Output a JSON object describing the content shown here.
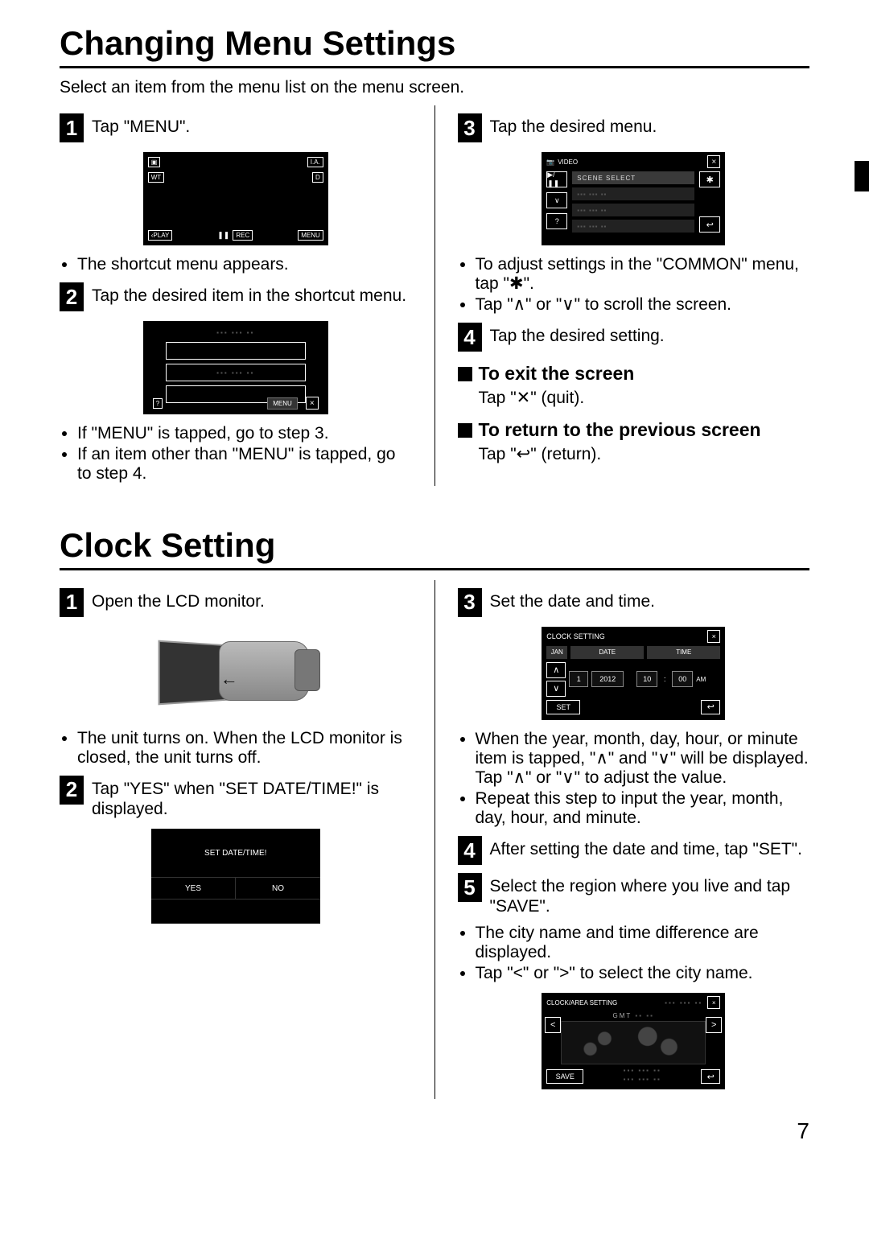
{
  "section1": {
    "title": "Changing Menu Settings",
    "intro": "Select an item from the menu list on the menu screen.",
    "left": {
      "step1": {
        "text": "Tap \"MENU\".",
        "lcd": {
          "wt": "WT",
          "ia": "I.A.",
          "d": "D",
          "play": "PLAY",
          "play_prefix": "‹",
          "rec": "REC",
          "rec_prefix": "❚❚",
          "menu": "MENU",
          "img_icon": "▣"
        },
        "bullets": [
          "The shortcut menu appears."
        ]
      },
      "step2": {
        "text": "Tap the desired item in the shortcut menu.",
        "lcd": {
          "menu": "MENU",
          "close": "×",
          "help": "?"
        },
        "bullets": [
          "If \"MENU\" is tapped, go to step 3.",
          "If an item other than \"MENU\" is tapped, go to step 4."
        ]
      }
    },
    "right": {
      "step3": {
        "text": "Tap the desired menu.",
        "lcd": {
          "video": "VIDEO",
          "scene_select": "SCENE SELECT",
          "close": "×",
          "gear": "✱",
          "return": "↩",
          "play_toggle": "▶/❚❚",
          "down": "∨",
          "help": "?"
        },
        "bullets": [
          "To adjust settings in the \"COMMON\" menu, tap \"✱\".",
          "Tap \"∧\" or \"∨\" to scroll the screen."
        ]
      },
      "step4": {
        "text": "Tap the desired setting."
      },
      "exit": {
        "heading": "To exit the screen",
        "text": "Tap \"✕\" (quit)."
      },
      "return": {
        "heading": "To return to the previous screen",
        "text": "Tap \"↩\" (return)."
      }
    }
  },
  "section2": {
    "title": "Clock Setting",
    "left": {
      "step1": {
        "text": "Open the LCD monitor.",
        "bullets": [
          "The unit turns on. When the LCD monitor is closed, the unit turns off."
        ]
      },
      "step2": {
        "text": "Tap \"YES\" when \"SET DATE/TIME!\" is displayed.",
        "lcd": {
          "title": "SET DATE/TIME!",
          "yes": "YES",
          "no": "NO"
        }
      }
    },
    "right": {
      "step3": {
        "text": "Set the date and time.",
        "lcd": {
          "title": "CLOCK SETTING",
          "close": "×",
          "month_label": "JAN",
          "date_label": "DATE",
          "time_label": "TIME",
          "day": "1",
          "year": "2012",
          "hour": "10",
          "colon": ":",
          "minute": "00",
          "ampm": "AM",
          "up": "∧",
          "down": "∨",
          "set": "SET",
          "return": "↩"
        },
        "bullets": [
          "When the year, month, day, hour, or minute item is tapped, \"∧\" and \"∨\" will be displayed. Tap \"∧\" or \"∨\" to adjust the value.",
          "Repeat this step to input the year, month, day, hour, and minute."
        ]
      },
      "step4": {
        "text": "After setting the date and time, tap \"SET\"."
      },
      "step5": {
        "text": "Select the region where you live and tap \"SAVE\".",
        "bullets": [
          "The city name and time difference are displayed.",
          "Tap \"<\" or \">\" to select the city name."
        ],
        "lcd": {
          "title": "CLOCK/AREA SETTING",
          "gmt": "GMT",
          "close": "×",
          "left": "<",
          "right": ">",
          "save": "SAVE",
          "return": "↩"
        }
      }
    }
  },
  "page_number": "7"
}
